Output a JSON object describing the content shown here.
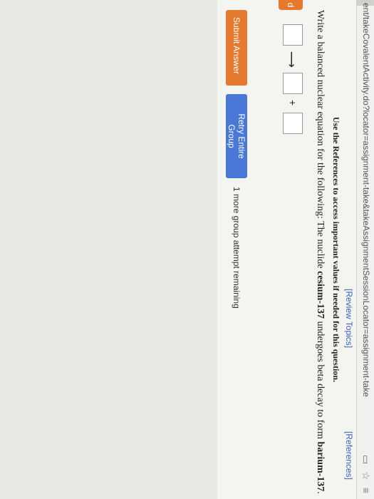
{
  "browser": {
    "url": "ent/takeCovalentActivity.do?locator=assignment-take&takeAssignmentSessionLocator=assignment-take",
    "icons": [
      "reader-icon",
      "star-icon",
      "menu-icon"
    ]
  },
  "links": {
    "review_topics": "[Review Topics]",
    "references": "[References]"
  },
  "hint": "Use the References to access important values if needed for this question.",
  "question": {
    "prefix": "Write a balanced nuclear equation for the following: The nuclide ",
    "reactant": "cesium-137",
    "middle": " undergoes beta decay to form ",
    "product": "barium-137",
    "suffix": "."
  },
  "equation": {
    "side_tab": "d",
    "arrow": "⟶",
    "plus": "+"
  },
  "buttons": {
    "submit": "Submit Answer",
    "retry": "Retry Entire Group"
  },
  "remaining": "1 more group attempt remaining",
  "colors": {
    "submit_button": "#e57a2e",
    "retry_button": "#4a78d6",
    "link": "#3a63b8"
  }
}
